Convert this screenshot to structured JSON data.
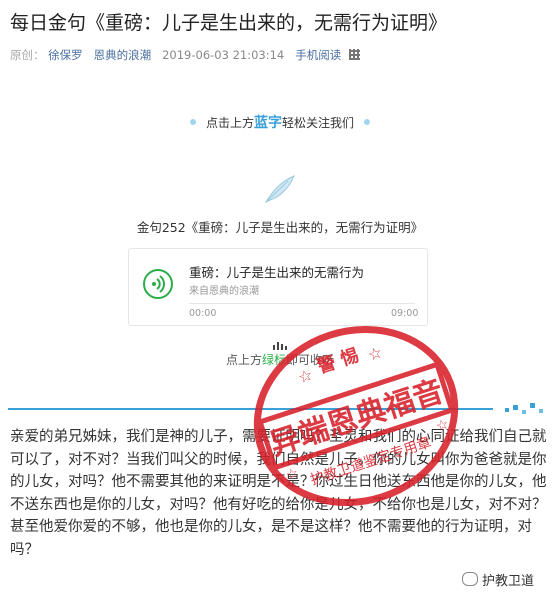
{
  "article": {
    "title": "每日金句《重磅：儿子是生出来的，无需行为证明》",
    "original_tag": "原创：",
    "author": "徐保罗",
    "account": "恩典的浪潮",
    "date": "2019-06-03 21:03:14",
    "mobile_read": "手机阅读"
  },
  "banner": {
    "before": "点击上方",
    "highlight": "蓝字",
    "after": "轻松关注我们"
  },
  "audio": {
    "heading": "金句252《重磅：儿子是生出来的，无需行为证明》",
    "title": "重磅：儿子是生出来的无需行为",
    "source": "来自恩典的浪潮",
    "current_time": "00:00",
    "duration": "09:00",
    "progress": 0
  },
  "play_hint": {
    "before": "点上方",
    "green": "绿标",
    "after": "即可收听"
  },
  "body_text": "亲爱的弟兄姊妹，我们是神的儿子，需要证明吗？圣灵和我们的心同证给我们自己就可以了，对不对？当我们叫父的时候，我们自然是儿子。你的儿女叫你为爸爸就是你的儿女，对吗？他不需要其他的来证明是不是？你过生日他送东西他是你的儿女，他不送东西也是你的儿女，对吗？他有好吃的给你是儿女，不给你也是儿女，对不对？甚至他爱你爱的不够，他也是你的儿女，是不是这样？他不需要他的行为证明，对吗？",
  "stamp": {
    "top_text": "警 惕",
    "main_text": "异端恩典福音",
    "bottom_text": "护教卫道鉴定专用章",
    "color": "#d8202a"
  },
  "watermark": {
    "text": "护教卫道"
  },
  "colors": {
    "accent_blue": "#3aa0d8",
    "play_green": "#2aae4a"
  }
}
